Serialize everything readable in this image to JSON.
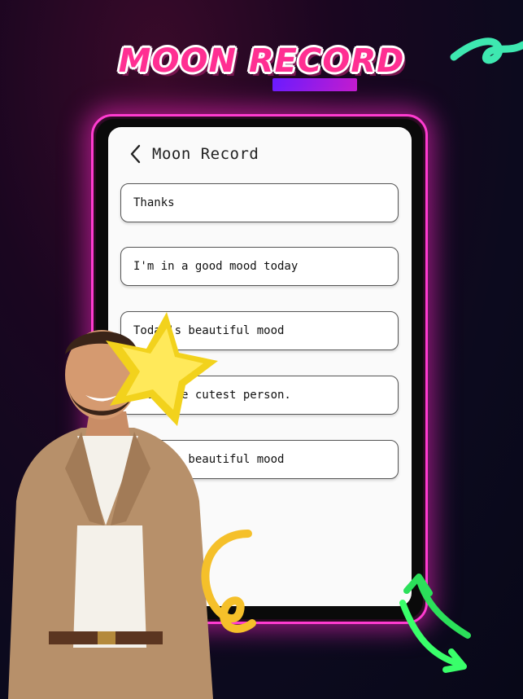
{
  "banner": {
    "title": "MOON RECORD"
  },
  "app": {
    "nav_title": "Moon Record",
    "records": [
      "Thanks",
      "I'm in a good mood today",
      "Today's beautiful mood",
      "I am the cutest person.",
      "Today's beautiful mood"
    ]
  },
  "colors": {
    "accent_pink": "#ff2f92",
    "neon_border": "#ff3bd0",
    "card_bg": "#ffffff",
    "screen_bg": "#fafafa"
  },
  "icons": [
    "back-chevron-icon",
    "star-decoration",
    "spiral-decoration",
    "arrows-decoration",
    "ribbon-decoration"
  ]
}
